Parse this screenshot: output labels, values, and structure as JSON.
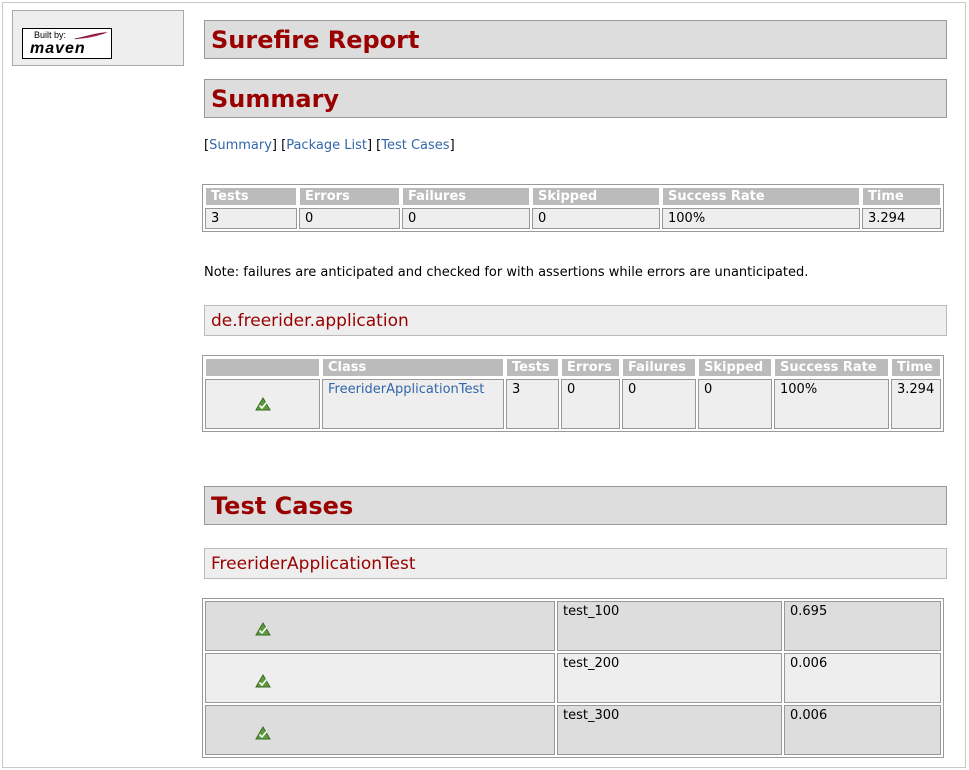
{
  "badge": {
    "built_by": "Built by:",
    "brand": "maven"
  },
  "headings": {
    "report_title": "Surefire Report",
    "summary": "Summary",
    "package": "de.freerider.application",
    "test_cases": "Test Cases",
    "test_class": "FreeriderApplicationTest"
  },
  "nav": {
    "summary": "Summary",
    "package_list": "Package List",
    "test_cases": "Test Cases",
    "open": "[",
    "close": "]"
  },
  "summary_table": {
    "headers": [
      "Tests",
      "Errors",
      "Failures",
      "Skipped",
      "Success Rate",
      "Time"
    ],
    "row": [
      "3",
      "0",
      "0",
      "0",
      "100%",
      "3.294"
    ]
  },
  "note": "Note: failures are anticipated and checked for with assertions while errors are unanticipated.",
  "package_table": {
    "headers": [
      "",
      "Class",
      "Tests",
      "Errors",
      "Failures",
      "Skipped",
      "Success Rate",
      "Time"
    ],
    "row": {
      "icon": "success-icon",
      "class": "FreeriderApplicationTest",
      "tests": "3",
      "errors": "0",
      "failures": "0",
      "skipped": "0",
      "success_rate": "100%",
      "time": "3.294"
    }
  },
  "test_cases": [
    {
      "icon": "success-icon",
      "name": "test_100",
      "time": "0.695"
    },
    {
      "icon": "success-icon",
      "name": "test_200",
      "time": "0.006"
    },
    {
      "icon": "success-icon",
      "name": "test_300",
      "time": "0.006"
    }
  ],
  "colors": {
    "heading": "#990000",
    "link": "#3366aa",
    "header_bg": "#bbbbbb",
    "row_a": "#dddddd",
    "row_b": "#eeeeee"
  }
}
